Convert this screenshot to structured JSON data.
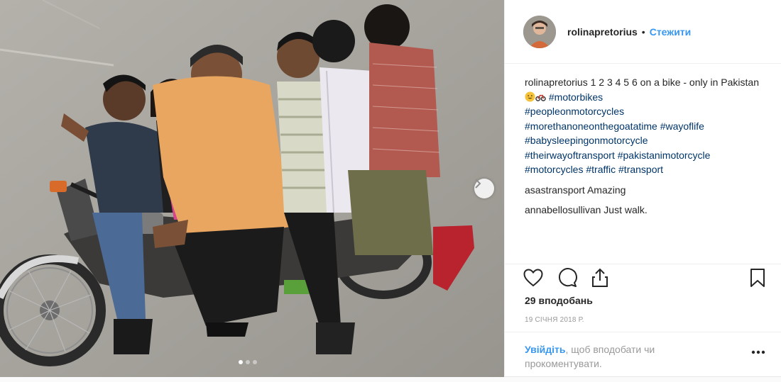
{
  "header": {
    "username": "rolinapretorius",
    "separator": "•",
    "follow_label": "Стежити"
  },
  "caption": {
    "username": "rolinapretorius",
    "text": " 1 2 3 4 5 6 on a bike - only in Pakistan ",
    "emojis": [
      "grinning-face-emoji",
      "motorcycle-emoji"
    ],
    "hashtags": [
      "#motorbikes",
      "#peopleonmotorcycles",
      "#morethanoneonthegoatatime",
      "#wayoflife",
      "#babysleepingonmotorcycle",
      "#theirwayoftransport",
      "#pakistanimotorcycle",
      "#motorcycles",
      "#traffic",
      "#transport"
    ]
  },
  "comments": [
    {
      "username": "asastransport",
      "text": " Amazing"
    },
    {
      "username": "annabellosullivan",
      "text": " Just walk."
    }
  ],
  "actions": {
    "icons": [
      "heart-icon",
      "comment-icon",
      "share-icon",
      "bookmark-icon"
    ],
    "likes": "29 вподобань",
    "date": "19 СІЧНЯ 2018 Р."
  },
  "login_prompt": {
    "link": "Увійдіть",
    "text": ", щоб вподобати чи прокоментувати."
  },
  "carousel": {
    "slide_count": 3,
    "active_slide": 1,
    "next_icon": "chevron-right-icon"
  },
  "photo": {
    "description_icon": "post-photo"
  }
}
